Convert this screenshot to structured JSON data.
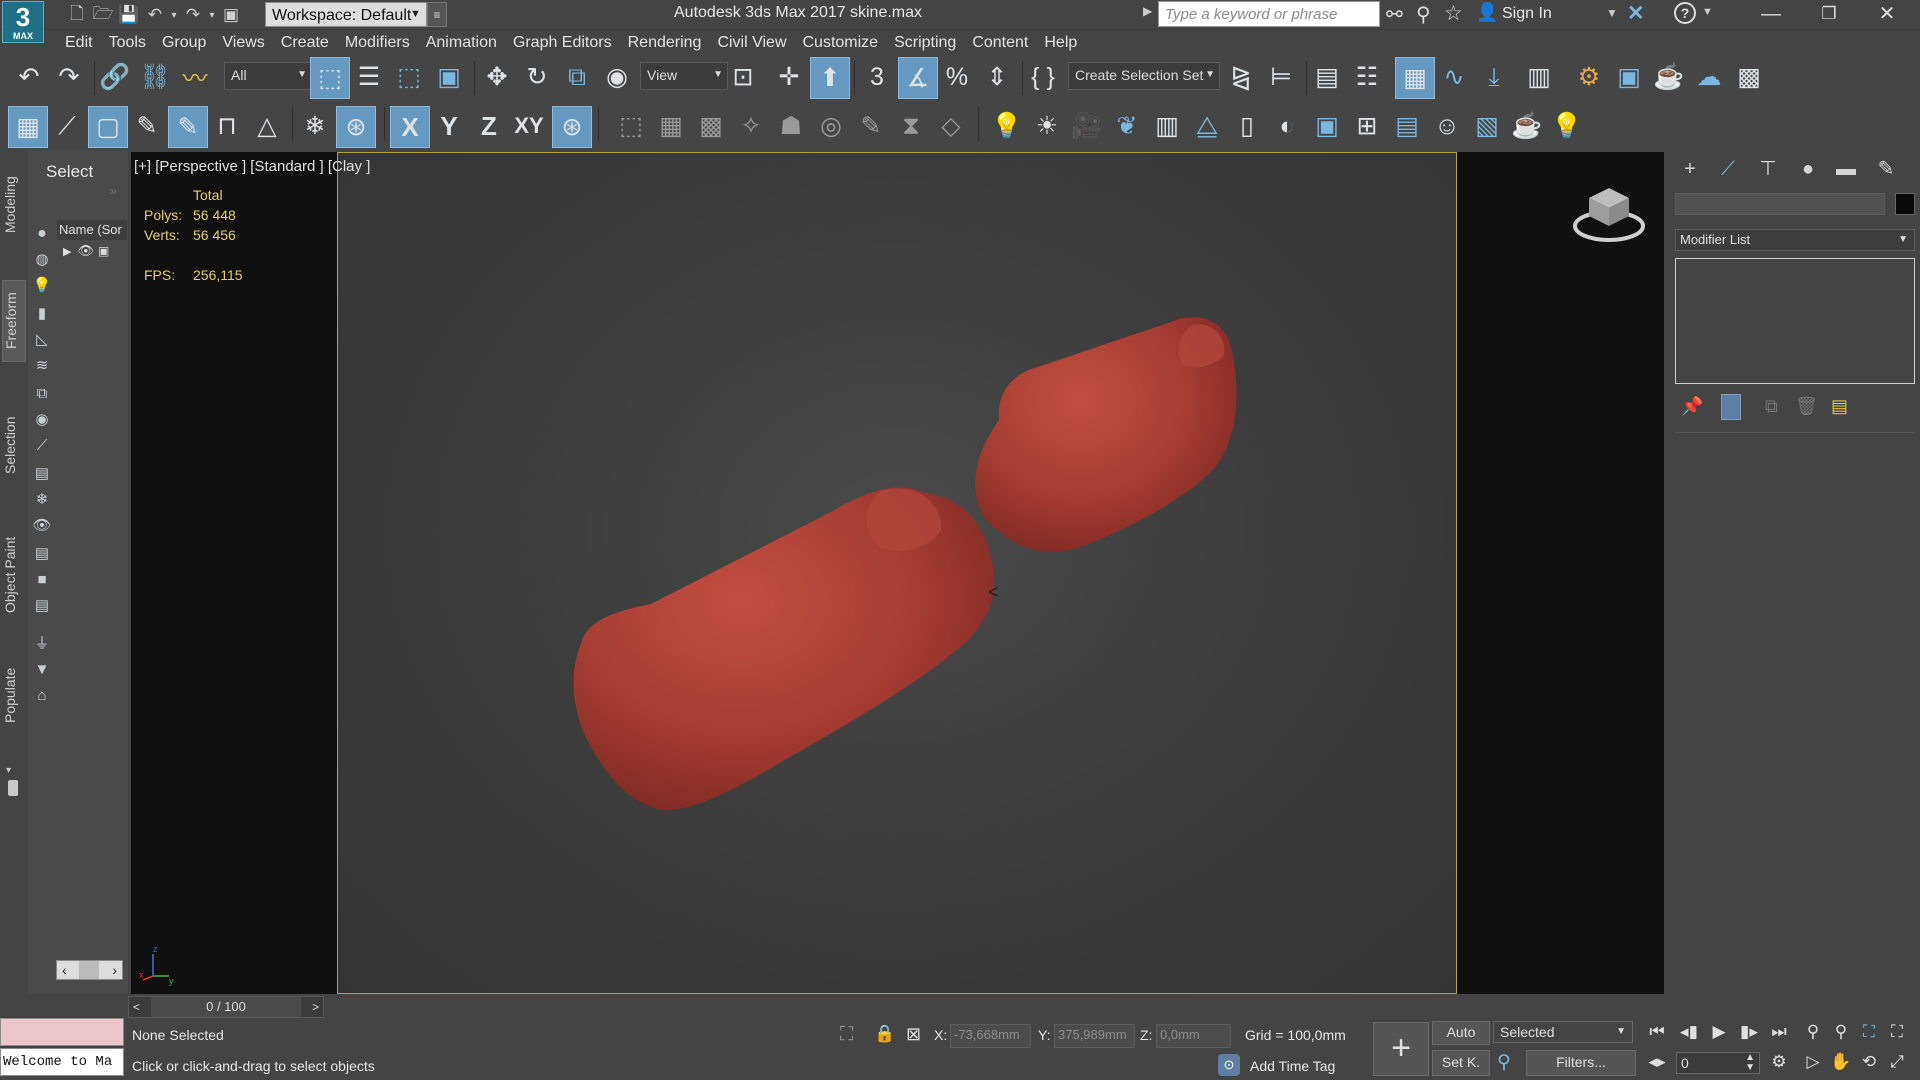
{
  "titlebar": {
    "logo_text": "3",
    "logo_sub": "MAX",
    "workspace": "Workspace: Default",
    "app_title": "Autodesk 3ds Max 2017",
    "filename": "skine.max",
    "search_placeholder": "Type a keyword or phrase",
    "sign_in": "Sign In"
  },
  "menu": [
    "Edit",
    "Tools",
    "Group",
    "Views",
    "Create",
    "Modifiers",
    "Animation",
    "Graph Editors",
    "Rendering",
    "Civil View",
    "Customize",
    "Scripting",
    "Content",
    "Help"
  ],
  "toolbar": {
    "selection_filter": "All",
    "reference_coord": "View",
    "named_selection": "Create Selection Set",
    "axis_x": "X",
    "axis_y": "Y",
    "axis_z": "Z",
    "axis_xy": "XY",
    "snap_3": "3",
    "snap_percent": "%"
  },
  "left_tabs": [
    "Modeling",
    "Freeform",
    "Selection",
    "Object Paint",
    "Populate"
  ],
  "scene_explorer": {
    "title": "Select",
    "column_header": "Name (Sor"
  },
  "viewport": {
    "label": "[+] [Perspective ] [Standard ] [Clay ]",
    "stats_header": "Total",
    "polys_label": "Polys:",
    "polys_value": "56 448",
    "verts_label": "Verts:",
    "verts_value": "56 456",
    "fps_label": "FPS:",
    "fps_value": "256,115",
    "sofa_color": "#b5453a"
  },
  "command_panel": {
    "modifier_list": "Modifier List"
  },
  "bottom": {
    "time_slider": "0 / 100",
    "maxscript_output": "Welcome to Ma",
    "status": "None Selected",
    "prompt": "Click or click-and-drag to select objects",
    "x_label": "X:",
    "x_value": "-73,668mm",
    "y_label": "Y:",
    "y_value": "375,989mm",
    "z_label": "Z:",
    "z_value": "0,0mm",
    "grid": "Grid = 100,0mm",
    "add_time_tag": "Add Time Tag",
    "auto_key": "Auto",
    "set_key": "Set K.",
    "key_filter_combo": "Selected",
    "filters": "Filters...",
    "current_frame": "0"
  }
}
